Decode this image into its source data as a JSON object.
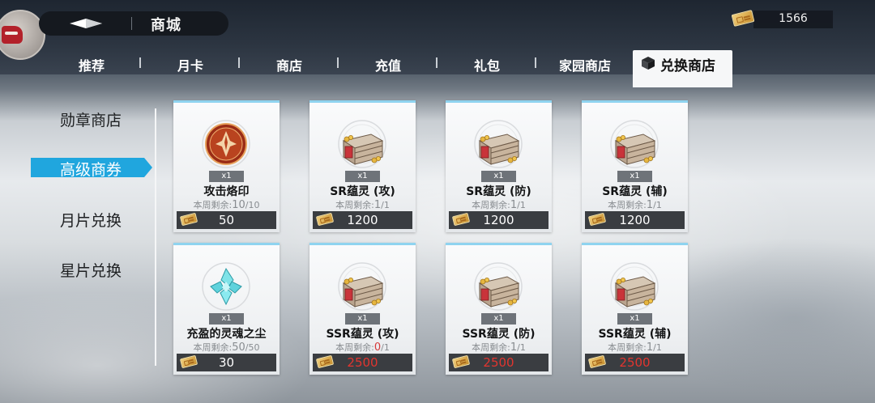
{
  "header": {
    "title": "商城",
    "currency_amount": "1566"
  },
  "tabs": [
    {
      "label": "推荐"
    },
    {
      "label": "月卡"
    },
    {
      "label": "商店"
    },
    {
      "label": "充值"
    },
    {
      "label": "礼包"
    },
    {
      "label": "家园商店"
    }
  ],
  "active_tab": {
    "label": "兑换商店",
    "icon": "cube-icon"
  },
  "sidebar": {
    "items": [
      {
        "label": "勋章商店"
      },
      {
        "label": "高级商券"
      },
      {
        "label": "月片兑换"
      },
      {
        "label": "星片兑换"
      }
    ],
    "active_index": 1
  },
  "cards": [
    {
      "name": "攻击烙印",
      "qty": "x1",
      "stock_prefix": "本周剩余:",
      "stock_remaining": "10",
      "stock_total": "/10",
      "price": "50",
      "icon": "emblem-icon",
      "sold_out": false
    },
    {
      "name": "SR蕴灵 (攻)",
      "qty": "x1",
      "stock_prefix": "本周剩余:",
      "stock_remaining": "1",
      "stock_total": "/1",
      "price": "1200",
      "icon": "treasure-chest-icon",
      "sold_out": false
    },
    {
      "name": "SR蕴灵 (防)",
      "qty": "x1",
      "stock_prefix": "本周剩余:",
      "stock_remaining": "1",
      "stock_total": "/1",
      "price": "1200",
      "icon": "treasure-chest-icon",
      "sold_out": false
    },
    {
      "name": "SR蕴灵 (辅)",
      "qty": "x1",
      "stock_prefix": "本周剩余:",
      "stock_remaining": "1",
      "stock_total": "/1",
      "price": "1200",
      "icon": "treasure-chest-icon",
      "sold_out": false
    },
    {
      "name": "充盈的灵魂之尘",
      "qty": "x1",
      "stock_prefix": "本周剩余:",
      "stock_remaining": "50",
      "stock_total": "/50",
      "price": "30",
      "icon": "crystal-icon",
      "sold_out": false
    },
    {
      "name": "SSR蕴灵 (攻)",
      "qty": "x1",
      "stock_prefix": "本周剩余:",
      "stock_remaining": "0",
      "stock_total": "/1",
      "price": "2500",
      "icon": "treasure-chest-icon",
      "sold_out": true
    },
    {
      "name": "SSR蕴灵 (防)",
      "qty": "x1",
      "stock_prefix": "本周剩余:",
      "stock_remaining": "1",
      "stock_total": "/1",
      "price": "2500",
      "icon": "treasure-chest-icon",
      "sold_out": false
    },
    {
      "name": "SSR蕴灵 (辅)",
      "qty": "x1",
      "stock_prefix": "本周剩余:",
      "stock_remaining": "1",
      "stock_total": "/1",
      "price": "2500",
      "icon": "treasure-chest-icon",
      "sold_out": false
    }
  ],
  "colors": {
    "accent": "#20a6de",
    "price_unaffordable": "#e2352f",
    "price_normal": "#ffffff"
  }
}
